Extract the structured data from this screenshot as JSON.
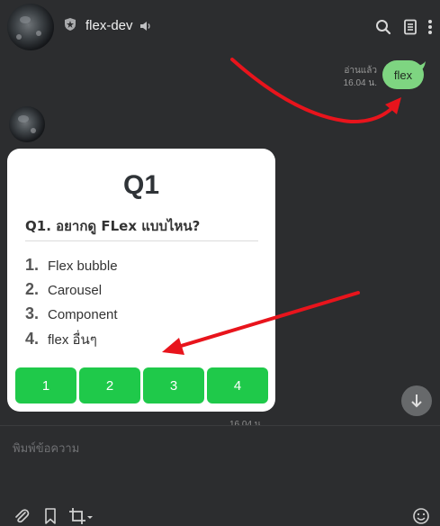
{
  "header": {
    "chat_name": "flex-dev",
    "icons": [
      "avatar",
      "shield-icon",
      "speaker-icon",
      "search-icon",
      "notes-icon",
      "more-icon"
    ]
  },
  "sent_message": {
    "read_label": "อ่านแล้ว",
    "time": "16.04 น.",
    "text": "flex",
    "bubble_color": "#7ed581"
  },
  "flex_card": {
    "title": "Q1",
    "question": "Q1. อยากดู FLex แบบไหน?",
    "options": [
      {
        "num": "1.",
        "label": "Flex bubble"
      },
      {
        "num": "2.",
        "label": "Carousel"
      },
      {
        "num": "3.",
        "label": "Component"
      },
      {
        "num": "4.",
        "label": "flex อื่นๆ"
      }
    ],
    "buttons": [
      "1",
      "2",
      "3",
      "4"
    ],
    "button_color": "#1fc94a"
  },
  "received_time": "16.04 น.",
  "input": {
    "placeholder": "พิมพ์ข้อความ"
  },
  "toolbar": {
    "icons": [
      "paperclip-icon",
      "bookmark-icon",
      "crop-icon",
      "emoji-icon"
    ]
  },
  "annotation_color": "#e8141c"
}
